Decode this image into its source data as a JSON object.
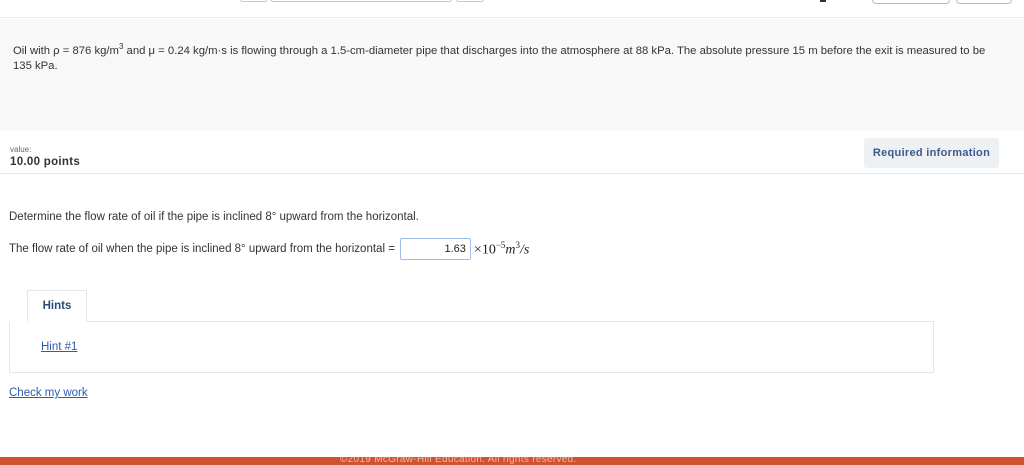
{
  "stem": {
    "text_prefix": "Oil with ρ = 876 kg/m",
    "sup1": "3",
    "text_mid": " and μ = 0.24 kg/m·s is flowing through a 1.5-cm-diameter pipe that discharges into the atmosphere at 88 kPa. The absolute pressure 15 m before the exit is measured to be 135 kPa."
  },
  "value": {
    "label": "value:",
    "points": "10.00 points"
  },
  "required_info_label": "Required information",
  "question": {
    "prompt": "Determine the flow rate of oil if the pipe is inclined 8° upward from the horizontal.",
    "answer_label": "The flow rate of oil when the pipe is inclined 8° upward from the horizontal =",
    "answer_value": "1.63",
    "unit_prefix": "×10",
    "unit_exp": "−5",
    "unit_m": "m",
    "unit_m_exp": "3",
    "unit_suffix": "/s"
  },
  "hints": {
    "tab_label": "Hints",
    "items": [
      "Hint #1"
    ]
  },
  "check_label": "Check my work",
  "footer": {
    "text": "©2019 McGraw-Hill Education. All rights reserved."
  },
  "colors": {
    "footer_bg": "#d2512e",
    "link": "#2a5db0",
    "required_button_bg": "#eef1f4"
  }
}
